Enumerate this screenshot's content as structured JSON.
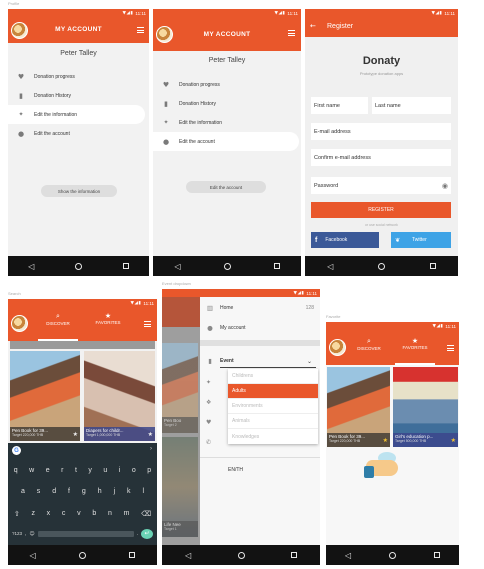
{
  "captions": {
    "s1": "Profile",
    "s4": "Search",
    "s5": "Event dropdown",
    "s6": "Favorite"
  },
  "status": {
    "icons": "▼◢▮",
    "time": "11:11"
  },
  "s1": {
    "title": "MY ACCOUNT",
    "name": "Peter Talley",
    "menu": [
      {
        "icon": "heart-icon",
        "glyph": "♥",
        "label": "Donation progress"
      },
      {
        "icon": "book-icon",
        "glyph": "▮",
        "label": "Donation History"
      },
      {
        "icon": "walk-icon",
        "glyph": "🚶",
        "label": "Edit the information"
      },
      {
        "icon": "person-icon",
        "glyph": "👤",
        "label": "Edit the account"
      }
    ],
    "button": "Show the information"
  },
  "s2": {
    "title": "MY ACCOUNT",
    "name": "Peter Talley",
    "menu": [
      {
        "icon": "heart-icon",
        "glyph": "♥",
        "label": "Donation progress"
      },
      {
        "icon": "book-icon",
        "glyph": "▮",
        "label": "Donation History"
      },
      {
        "icon": "walk-icon",
        "glyph": "🚶",
        "label": "Edit the information"
      },
      {
        "icon": "person-icon",
        "glyph": "👤",
        "label": "Edit the account"
      }
    ],
    "button": "Edit the account"
  },
  "s3": {
    "title": "Register",
    "logo": "Donaty",
    "tagline": "Prototype donation apps",
    "first_name": "First name",
    "last_name": "Last name",
    "email": "E-mail address",
    "confirm_email": "Confirm e-mail address",
    "password": "Password",
    "register": "REGISTER",
    "divider": "or use social network",
    "facebook": "Facebook",
    "twitter": "Twitter"
  },
  "s4": {
    "tab_discover": "DISCOVER",
    "tab_favorites": "FAVORITES",
    "cards": [
      {
        "title": "Pen Book for 39...",
        "target": "Target 220,000 THB"
      },
      {
        "title": "Diapers for childr...",
        "target": "Target 1,000,000 THB"
      }
    ],
    "keys_row1": [
      "q",
      "w",
      "e",
      "r",
      "t",
      "y",
      "u",
      "i",
      "o",
      "p"
    ],
    "keys_row2": [
      "a",
      "s",
      "d",
      "f",
      "g",
      "h",
      "j",
      "k",
      "l"
    ],
    "keys_row3": [
      "z",
      "x",
      "c",
      "v",
      "b",
      "n",
      "m"
    ],
    "key_sym": "?123"
  },
  "s5": {
    "home": "Home",
    "home_count": "128",
    "my_account": "My account",
    "event_label": "Event",
    "options": [
      "Childrens",
      "Adults",
      "Environments",
      "Animals",
      "Knowledges"
    ],
    "selected": "Adults",
    "language": "EN/TH",
    "bg_card_1": "Pen Boo",
    "bg_card_1_target": "Target 2",
    "bg_card_2": "Life Nee",
    "bg_card_2_target": "Target 1"
  },
  "s6": {
    "tab_discover": "DISCOVER",
    "tab_favorites": "FAVORITES",
    "cards": [
      {
        "title": "Pen Book for 39...",
        "target": "Target 220,000 THB"
      },
      {
        "title": "Girl's education p...",
        "target": "Target 500,000 THB"
      }
    ]
  },
  "colors": {
    "accent": "#e9572b",
    "facebook": "#3b5998",
    "twitter": "#3ea3e6",
    "star": "#f2c230"
  }
}
